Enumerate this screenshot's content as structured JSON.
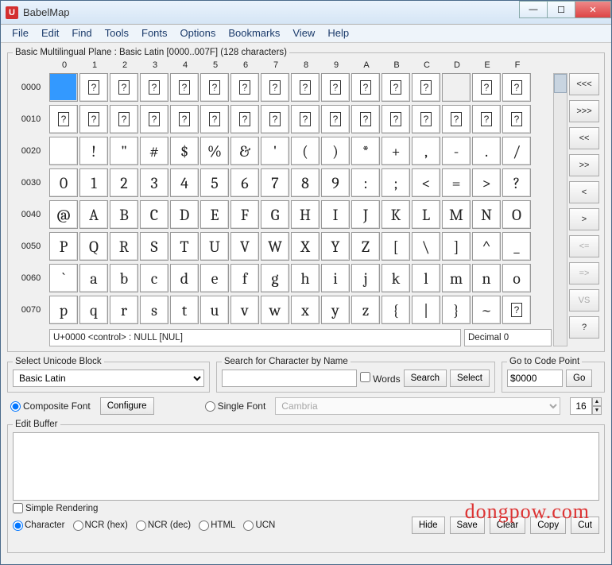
{
  "window": {
    "icon_letter": "U",
    "title": "BabelMap"
  },
  "menu": [
    "File",
    "Edit",
    "Find",
    "Tools",
    "Fonts",
    "Options",
    "Bookmarks",
    "View",
    "Help"
  ],
  "plane": {
    "legend": "Basic Multilingual Plane : Basic Latin [0000..007F] (128 characters)"
  },
  "cols": [
    "0",
    "1",
    "2",
    "3",
    "4",
    "5",
    "6",
    "7",
    "8",
    "9",
    "A",
    "B",
    "C",
    "D",
    "E",
    "F"
  ],
  "rows": [
    {
      "label": "0000",
      "cells": [
        "",
        "?",
        "?",
        "?",
        "?",
        "?",
        "?",
        "?",
        "?",
        "?",
        "?",
        "?",
        "?",
        "",
        "?",
        "?"
      ],
      "boxed": [
        1,
        2,
        3,
        4,
        5,
        6,
        7,
        8,
        9,
        10,
        11,
        12,
        14,
        15
      ],
      "empty": [
        13
      ],
      "selected": 0
    },
    {
      "label": "0010",
      "cells": [
        "?",
        "?",
        "?",
        "?",
        "?",
        "?",
        "?",
        "?",
        "?",
        "?",
        "?",
        "?",
        "?",
        "?",
        "?",
        "?"
      ],
      "boxed": [
        0,
        1,
        2,
        3,
        4,
        5,
        6,
        7,
        8,
        9,
        10,
        11,
        12,
        13,
        14,
        15
      ]
    },
    {
      "label": "0020",
      "cells": [
        "",
        "!",
        "\"",
        "#",
        "$",
        "%",
        "&",
        "'",
        "(",
        ")",
        "*",
        "+",
        ",",
        "-",
        ".",
        "/"
      ]
    },
    {
      "label": "0030",
      "cells": [
        "0",
        "1",
        "2",
        "3",
        "4",
        "5",
        "6",
        "7",
        "8",
        "9",
        ":",
        ";",
        "<",
        "=",
        ">",
        "?"
      ]
    },
    {
      "label": "0040",
      "cells": [
        "@",
        "A",
        "B",
        "C",
        "D",
        "E",
        "F",
        "G",
        "H",
        "I",
        "J",
        "K",
        "L",
        "M",
        "N",
        "O"
      ]
    },
    {
      "label": "0050",
      "cells": [
        "P",
        "Q",
        "R",
        "S",
        "T",
        "U",
        "V",
        "W",
        "X",
        "Y",
        "Z",
        "[",
        "\\",
        "]",
        "^",
        "_"
      ]
    },
    {
      "label": "0060",
      "cells": [
        "`",
        "a",
        "b",
        "c",
        "d",
        "e",
        "f",
        "g",
        "h",
        "i",
        "j",
        "k",
        "l",
        "m",
        "n",
        "o"
      ]
    },
    {
      "label": "0070",
      "cells": [
        "p",
        "q",
        "r",
        "s",
        "t",
        "u",
        "v",
        "w",
        "x",
        "y",
        "z",
        "{",
        "|",
        "}",
        "~",
        "?"
      ],
      "boxed": [
        15
      ]
    }
  ],
  "nav": [
    "<<<",
    ">>>",
    "<<",
    ">>",
    "<",
    ">",
    "<=",
    "=>",
    "VS",
    "?"
  ],
  "nav_disabled": [
    6,
    7,
    8
  ],
  "status": {
    "codepoint": "U+0000 <control> : NULL [NUL]",
    "decimal": "Decimal 0"
  },
  "block": {
    "legend": "Select Unicode Block",
    "value": "Basic Latin"
  },
  "search": {
    "legend": "Search for Character by Name",
    "value": "",
    "words": "Words",
    "search_btn": "Search",
    "select_btn": "Select"
  },
  "goto": {
    "legend": "Go to Code Point",
    "value": "$0000",
    "go_btn": "Go"
  },
  "font": {
    "composite": "Composite Font",
    "configure": "Configure",
    "single": "Single Font",
    "fontname": "Cambria",
    "size": "16"
  },
  "edit": {
    "legend": "Edit Buffer",
    "value": "",
    "simple": "Simple Rendering",
    "modes": [
      "Character",
      "NCR (hex)",
      "NCR (dec)",
      "HTML",
      "UCN"
    ],
    "btns": [
      "Hide",
      "Save",
      "Clear",
      "Copy",
      "Cut"
    ]
  },
  "watermark": "dongpow.com"
}
